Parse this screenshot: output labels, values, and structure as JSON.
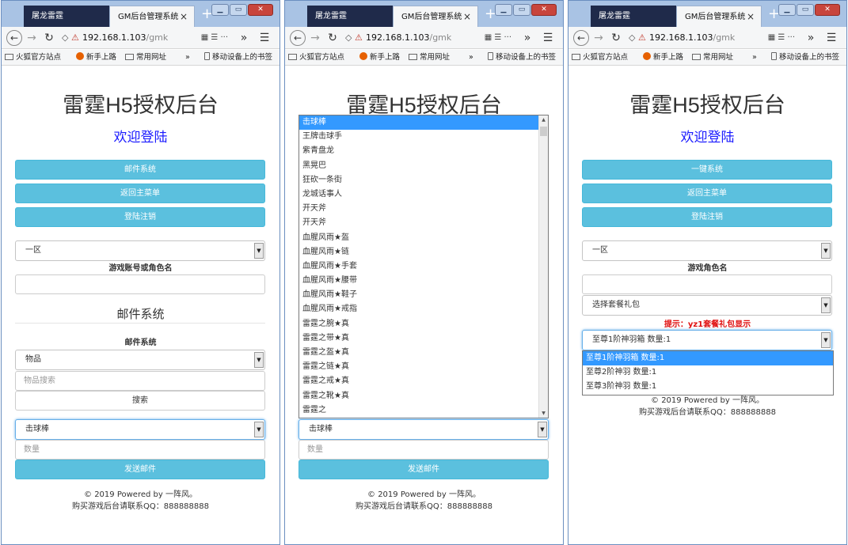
{
  "browser": {
    "tab_inactive": "屠龙雷霆",
    "tab_active": "GM后台管理系统",
    "tab_close": "×",
    "new_tab": "+",
    "url_host": "192.168.1.103",
    "url_path": "/gmk",
    "url_extra": "▦ ☰ ···",
    "overflow": "»",
    "menu": "☰",
    "bookmarks": [
      "火狐官方站点",
      "新手上路",
      "常用网址"
    ],
    "bookmarks_more": "»",
    "mobile_bookmarks": "移动设备上的书签"
  },
  "page": {
    "title": "雷霆H5授权后台",
    "welcome": "欢迎登陆",
    "footer_line1": "© 2019 Powered by 一阵风。",
    "footer_line2": "购买游戏后台请联系QQ：888888888"
  },
  "screen1": {
    "buttons": [
      "邮件系统",
      "返回主菜单",
      "登陆注销"
    ],
    "server_select": "一区",
    "account_label": "游戏账号或角色名",
    "section_title": "邮件系统",
    "mail_label": "邮件系统",
    "item_type_select": "物品",
    "item_search_placeholder": "物品搜索",
    "search_button": "搜索",
    "item_select": "击球棒",
    "quantity_placeholder": "数量",
    "send_button": "发送邮件"
  },
  "screen2": {
    "dropdown_options": [
      "击球棒",
      "王牌击球手",
      "紫青盘龙",
      "黑晃巴",
      "狂砍一条街",
      "龙城话事人",
      "开天斧",
      "开天斧",
      "血腥风雨★盔",
      "血腥风雨★链",
      "血腥风雨★手套",
      "血腥风雨★腰带",
      "血腥风雨★鞋子",
      "血腥风雨★戒指",
      "雷霆之腕★真",
      "雷霆之带★真",
      "雷霆之盔★真",
      "雷霆之链★真",
      "雷霆之戒★真",
      "雷霆之靴★真",
      "雷霆之"
    ],
    "item_select": "击球棒",
    "quantity_placeholder": "数量",
    "send_button": "发送邮件"
  },
  "screen3": {
    "buttons": [
      "一键系统",
      "返回主菜单",
      "登陆注销"
    ],
    "server_select": "一区",
    "role_label": "游戏角色名",
    "package_select": "选择套餐礼包",
    "hint": "提示：yz1套餐礼包显示",
    "package_item_select": "至尊1阶神羽箱 数量:1",
    "package_options": [
      "至尊1阶神羽箱 数量:1",
      "至尊2阶神羽 数量:1",
      "至尊3阶神羽 数量:1"
    ]
  }
}
